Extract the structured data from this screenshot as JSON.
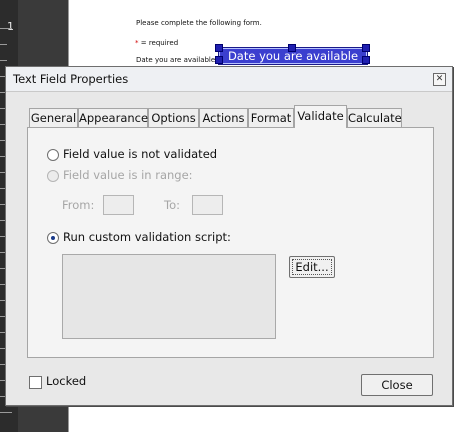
{
  "ruler": {
    "number": "1"
  },
  "document": {
    "instruction": "Please complete the following form.",
    "required_star": "*",
    "required_label": "= required",
    "field_label": "Date you are available:",
    "field_value": "Date you are available"
  },
  "dialog": {
    "title": "Text Field Properties",
    "tabs": [
      "General",
      "Appearance",
      "Options",
      "Actions",
      "Format",
      "Validate",
      "Calculate"
    ],
    "active_tab": "Validate",
    "validate": {
      "option_not_validated": "Field value is not validated",
      "option_in_range": "Field value is in range:",
      "from_label": "From:",
      "to_label": "To:",
      "from_value": "",
      "to_value": "",
      "option_custom_script": "Run custom validation script:",
      "selected_option": "custom",
      "script_text": "",
      "edit_button": "Edit..."
    },
    "locked_label": "Locked",
    "locked_checked": false,
    "close_button": "Close"
  },
  "colors": {
    "field_highlight": "#3b3fcf",
    "dialog_bg": "#e8e8e8",
    "panel_bg": "#f4f4f4",
    "disabled_text": "#a6a6a6"
  },
  "icons": {
    "dialog_close": "close-icon",
    "radio": "radio-button-icon"
  }
}
